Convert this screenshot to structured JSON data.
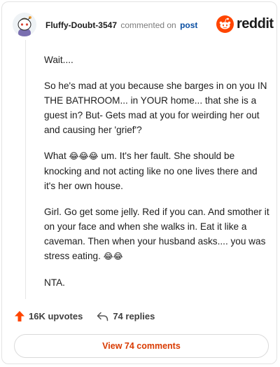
{
  "header": {
    "username": "Fluffy-Doubt-3547",
    "commented_text": "commented on",
    "post_link": "post",
    "brand": "reddit"
  },
  "comment": {
    "paragraphs": [
      "Wait....",
      "So he's mad at you because she barges in on you IN THE BATHROOM... in YOUR home... that she is a guest in? But- Gets mad at you for weirding her out and causing her 'grief'?",
      "What",
      "um. It's her fault. She should be knocking and not acting like no one lives there and it's her own house.",
      "Girl. Go get some jelly. Red if you can. And smother it on your face and when she walks in. Eat it like a caveman. Then when your husband asks.... you was stress eating.",
      "NTA."
    ],
    "emoji_group_1": "😂😂😂",
    "emoji_group_2": "😂😂"
  },
  "actions": {
    "upvotes": "16K upvotes",
    "replies": "74 replies"
  },
  "view_button": "View 74 comments",
  "colors": {
    "accent": "#d93a00",
    "link": "#0a4fa3",
    "reddit_orange": "#ff4500"
  },
  "icons": {
    "avatar": "snoo-avatar-icon",
    "logo": "reddit-logo-icon",
    "upvote": "upvote-arrow-icon",
    "reply": "reply-arrow-icon"
  }
}
